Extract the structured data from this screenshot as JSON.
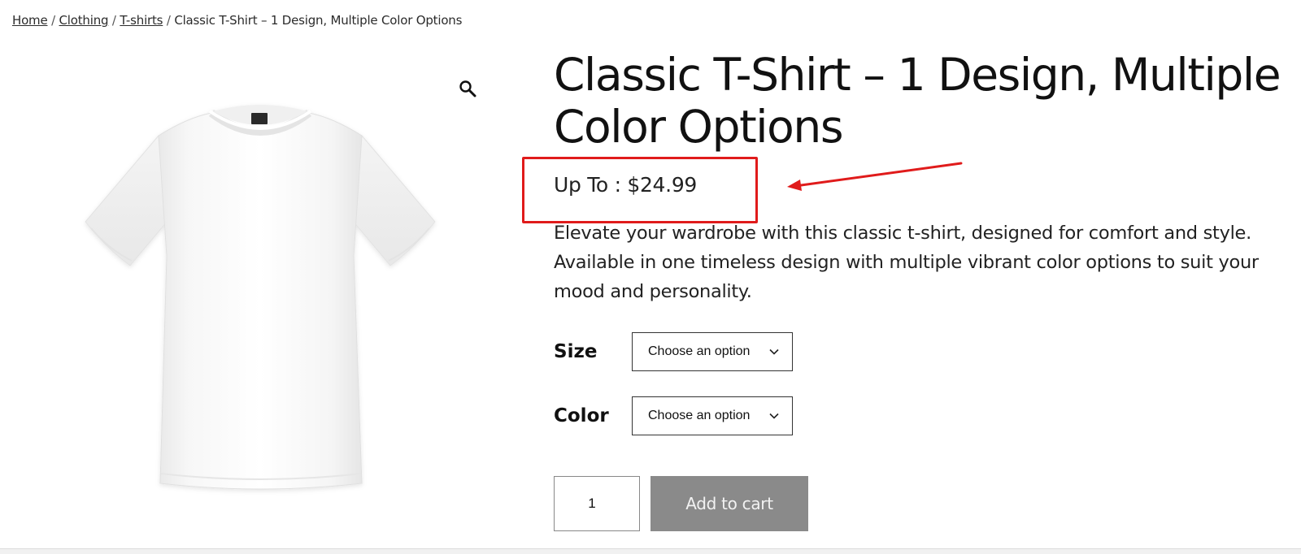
{
  "breadcrumb": {
    "items": [
      {
        "label": "Home"
      },
      {
        "label": "Clothing"
      },
      {
        "label": "T-shirts"
      }
    ],
    "current": "Classic T-Shirt – 1 Design, Multiple Color Options",
    "separator": "/"
  },
  "product": {
    "title": "Classic T-Shirt – 1 Design, Multiple Color Options",
    "price": "Up To : $24.99",
    "description": "Elevate your wardrobe with this classic t-shirt, designed for comfort and style. Available in one timeless design with multiple vibrant color options to suit your mood and personality."
  },
  "variations": {
    "size": {
      "label": "Size",
      "selected": "Choose an option"
    },
    "color": {
      "label": "Color",
      "selected": "Choose an option"
    }
  },
  "cart": {
    "quantity": "1",
    "add_to_cart_label": "Add to cart"
  },
  "icons": {
    "zoom": "magnifier-icon",
    "dropdown": "chevron-down-icon"
  },
  "colors": {
    "annotation": "#e01b1b",
    "button_bg": "#8a8a8a"
  }
}
